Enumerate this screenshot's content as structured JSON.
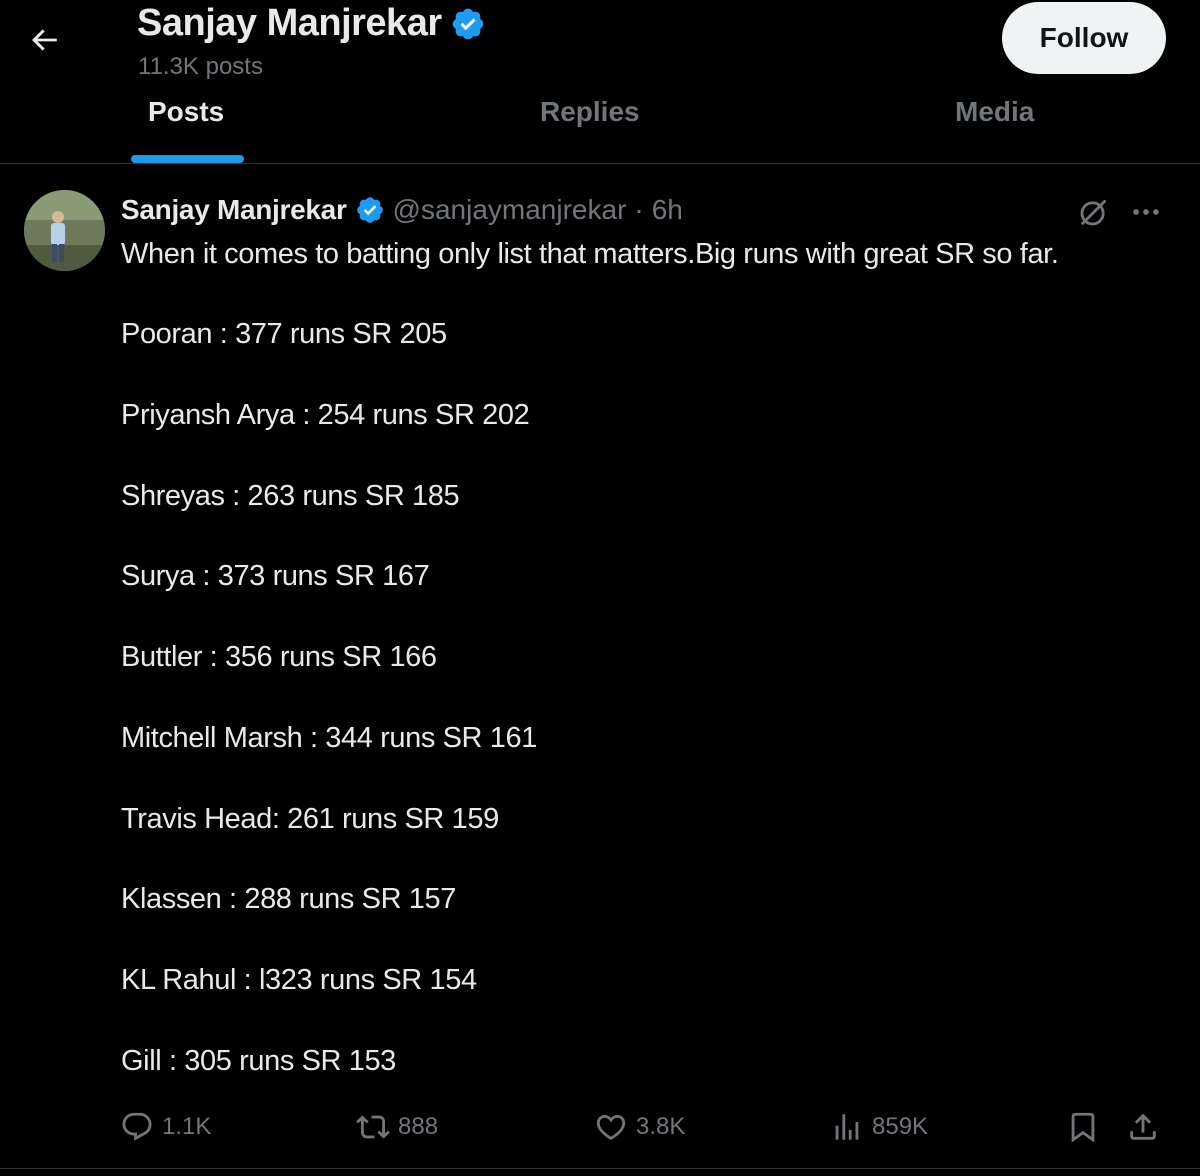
{
  "header": {
    "profile_name": "Sanjay Manjrekar",
    "post_count": "11.3K posts",
    "follow_label": "Follow"
  },
  "tabs": [
    {
      "label": "Posts",
      "active": true
    },
    {
      "label": "Replies",
      "active": false
    },
    {
      "label": "Media",
      "active": false
    }
  ],
  "tweet": {
    "author_name": "Sanjay Manjrekar",
    "handle": "@sanjaymanjrekar",
    "separator": "·",
    "time": "6h",
    "text_intro": "When it comes to batting only list that matters.Big runs with great SR so far.",
    "stats": [
      "Pooran : 377 runs SR 205",
      "Priyansh Arya : 254 runs SR 202",
      "Shreyas : 263 runs SR 185",
      "Surya : 373 runs SR 167",
      "Buttler : 356 runs SR 166",
      "Mitchell Marsh : 344 runs SR 161",
      "Travis Head: 261 runs SR 159",
      "Klassen : 288 runs SR 157",
      "KL Rahul : l323 runs SR 154",
      "Gill : 305 runs SR 153"
    ],
    "actions": {
      "replies": "1.1K",
      "reposts": "888",
      "likes": "3.8K",
      "views": "859K"
    }
  },
  "icons": {
    "back": "arrow-left-icon",
    "verified": "verified-badge-icon",
    "grok": "grok-icon",
    "more": "more-icon",
    "reply": "reply-icon",
    "repost": "repost-icon",
    "like": "heart-icon",
    "views": "views-icon",
    "bookmark": "bookmark-icon",
    "share": "share-icon"
  },
  "colors": {
    "background": "#000000",
    "text": "#e7e9ea",
    "muted": "#71767b",
    "accent": "#1d9bf0",
    "divider": "#2f3336"
  }
}
